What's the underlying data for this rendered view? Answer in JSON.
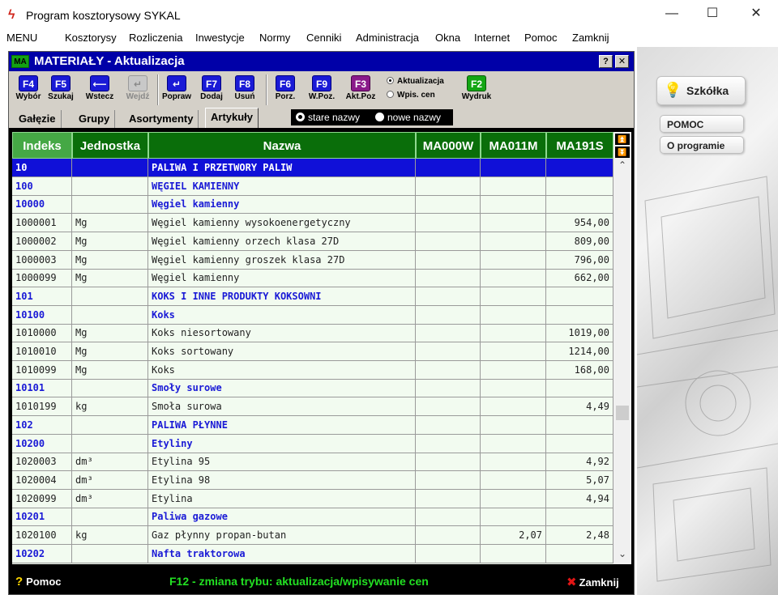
{
  "app": {
    "title": "Program kosztorysowy SYKAL",
    "icon": "sykal-logo-icon"
  },
  "menu": [
    "MENU",
    "Kosztorysy",
    "Rozliczenia",
    "Inwestycje",
    "Normy",
    "Cenniki",
    "Administracja",
    "Okna",
    "Internet",
    "Pomoc",
    "Zamknij"
  ],
  "window": {
    "badge": "MA",
    "title": "MATERIAŁY - Aktualizacja",
    "help": "?",
    "close": "✕"
  },
  "toolbar": [
    {
      "key": "F4",
      "label": "Wybór",
      "color": "blue"
    },
    {
      "key": "F5",
      "label": "Szukaj",
      "color": "blue"
    },
    {
      "key": "⟵",
      "label": "Wstecz",
      "color": "blue"
    },
    {
      "key": "↵",
      "label": "Wejdź",
      "color": "grey"
    },
    {
      "key": "↵",
      "label": "Popraw",
      "color": "blue"
    },
    {
      "key": "F7",
      "label": "Dodaj",
      "color": "blue"
    },
    {
      "key": "F8",
      "label": "Usuń",
      "color": "blue"
    },
    {
      "key": "F6",
      "label": "Porz.",
      "color": "blue"
    },
    {
      "key": "F9",
      "label": "W.Poz.",
      "color": "blue"
    },
    {
      "key": "F3",
      "label": "Akt.Poz",
      "color": "purple"
    },
    {
      "key": "F2",
      "label": "Wydruk",
      "color": "green"
    }
  ],
  "mode": {
    "option1": "Aktualizacja",
    "option2": "Wpis. cen",
    "selected": "Aktualizacja"
  },
  "tabs": [
    "Gałęzie",
    "Grupy",
    "Asortymenty",
    "Artykuły"
  ],
  "active_tab": "Artykuły",
  "names_toggle": {
    "option1": "stare nazwy",
    "option2": "nowe nazwy",
    "selected": "stare nazwy"
  },
  "columns": [
    "Indeks",
    "Jednostka",
    "Nazwa",
    "MA000W",
    "MA011M",
    "MA191S"
  ],
  "rows": [
    {
      "idx": "10",
      "unit": "",
      "name": "PALIWA I PRZETWORY PALIW",
      "c1": "",
      "c2": "",
      "c3": "",
      "type": "group"
    },
    {
      "idx": "100",
      "unit": "",
      "name": "WĘGIEL KAMIENNY",
      "c1": "",
      "c2": "",
      "c3": "",
      "type": "group"
    },
    {
      "idx": "10000",
      "unit": "",
      "name": "Węgiel kamienny",
      "c1": "",
      "c2": "",
      "c3": "",
      "type": "group"
    },
    {
      "idx": "1000001",
      "unit": "Mg",
      "name": "Węgiel kamienny wysokoenergetyczny",
      "c1": "",
      "c2": "",
      "c3": "954,00",
      "type": "item"
    },
    {
      "idx": "1000002",
      "unit": "Mg",
      "name": "Węgiel kamienny orzech klasa 27D",
      "c1": "",
      "c2": "",
      "c3": "809,00",
      "type": "item"
    },
    {
      "idx": "1000003",
      "unit": "Mg",
      "name": "Węgiel kamienny groszek klasa 27D",
      "c1": "",
      "c2": "",
      "c3": "796,00",
      "type": "item"
    },
    {
      "idx": "1000099",
      "unit": "Mg",
      "name": "Węgiel kamienny",
      "c1": "",
      "c2": "",
      "c3": "662,00",
      "type": "item"
    },
    {
      "idx": "101",
      "unit": "",
      "name": "KOKS I INNE PRODUKTY KOKSOWNI",
      "c1": "",
      "c2": "",
      "c3": "",
      "type": "group"
    },
    {
      "idx": "10100",
      "unit": "",
      "name": "Koks",
      "c1": "",
      "c2": "",
      "c3": "",
      "type": "group"
    },
    {
      "idx": "1010000",
      "unit": "Mg",
      "name": "Koks niesortowany",
      "c1": "",
      "c2": "",
      "c3": "1019,00",
      "type": "item"
    },
    {
      "idx": "1010010",
      "unit": "Mg",
      "name": "Koks sortowany",
      "c1": "",
      "c2": "",
      "c3": "1214,00",
      "type": "item"
    },
    {
      "idx": "1010099",
      "unit": "Mg",
      "name": "Koks",
      "c1": "",
      "c2": "",
      "c3": "168,00",
      "type": "item"
    },
    {
      "idx": "10101",
      "unit": "",
      "name": "Smoły surowe",
      "c1": "",
      "c2": "",
      "c3": "",
      "type": "group"
    },
    {
      "idx": "1010199",
      "unit": "kg",
      "name": "Smoła surowa",
      "c1": "",
      "c2": "",
      "c3": "4,49",
      "type": "item"
    },
    {
      "idx": "102",
      "unit": "",
      "name": "PALIWA PŁYNNE",
      "c1": "",
      "c2": "",
      "c3": "",
      "type": "group"
    },
    {
      "idx": "10200",
      "unit": "",
      "name": "Etyliny",
      "c1": "",
      "c2": "",
      "c3": "",
      "type": "group"
    },
    {
      "idx": "1020003",
      "unit": "dm³",
      "name": "Etylina 95",
      "c1": "",
      "c2": "",
      "c3": "4,92",
      "type": "item"
    },
    {
      "idx": "1020004",
      "unit": "dm³",
      "name": "Etylina 98",
      "c1": "",
      "c2": "",
      "c3": "5,07",
      "type": "item"
    },
    {
      "idx": "1020099",
      "unit": "dm³",
      "name": "Etylina",
      "c1": "",
      "c2": "",
      "c3": "4,94",
      "type": "item"
    },
    {
      "idx": "10201",
      "unit": "",
      "name": "Paliwa gazowe",
      "c1": "",
      "c2": "",
      "c3": "",
      "type": "group"
    },
    {
      "idx": "1020100",
      "unit": "kg",
      "name": "Gaz płynny propan-butan",
      "c1": "",
      "c2": "2,07",
      "c3": "2,48",
      "type": "item"
    },
    {
      "idx": "10202",
      "unit": "",
      "name": "Nafta traktorowa",
      "c1": "",
      "c2": "",
      "c3": "",
      "type": "group"
    }
  ],
  "selected_row": 0,
  "status": {
    "help": "Pomoc",
    "message": "F12 - zmiana trybu: aktualizacja/wpisywanie cen",
    "close": "Zamknij"
  },
  "side": {
    "szkolka": "Szkółka",
    "pomoc": "POMOC",
    "oprogramie": "O programie"
  },
  "colors": {
    "header_blue": "#0000a8",
    "grid_green": "#0a6e0a",
    "selection": "#1010d8",
    "group_text": "#1a1ad6",
    "status_text": "#22e022"
  }
}
